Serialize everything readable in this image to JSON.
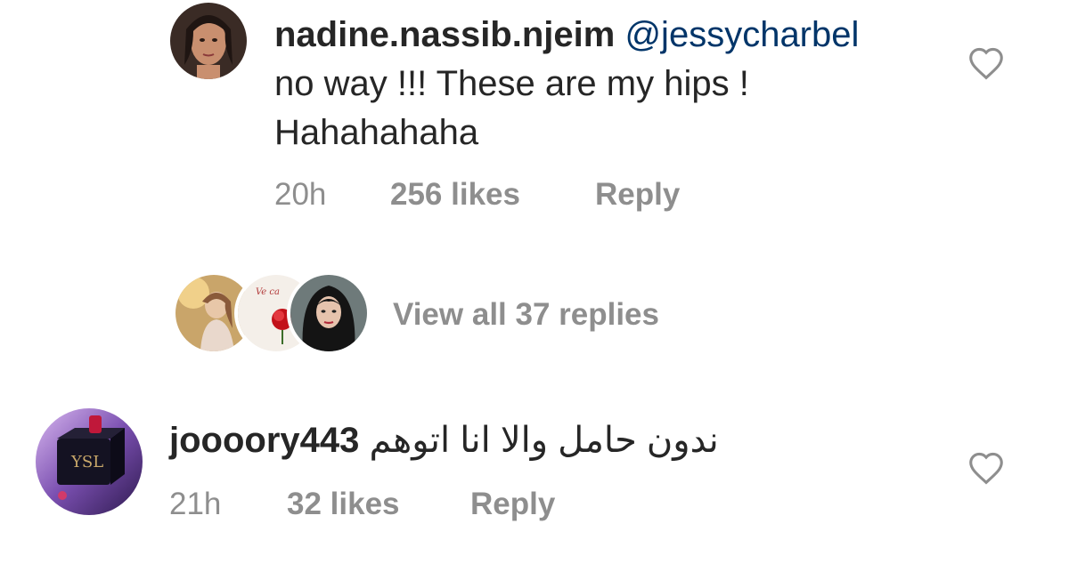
{
  "comments": [
    {
      "username": "nadine.nassib.njeim",
      "mention": "@jessycharbel",
      "text_line1": "no way !!! These are my hips !",
      "text_line2": "Hahahahaha",
      "time": "20h",
      "likes": "256 likes",
      "reply_label": "Reply",
      "heart_icon": "heart-outline-icon"
    },
    {
      "username": "joooory443",
      "text": "ندون حامل والا انا اتوهم",
      "time": "21h",
      "likes": "32 likes",
      "reply_label": "Reply",
      "heart_icon": "heart-outline-icon"
    }
  ],
  "replies": {
    "view_all_label": "View all 37 replies"
  },
  "colors": {
    "text": "#262626",
    "mention": "#003569",
    "secondary": "#8e8e8e"
  }
}
